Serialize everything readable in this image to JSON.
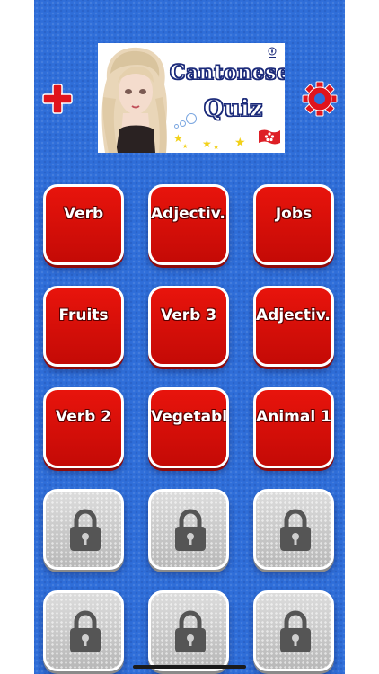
{
  "header": {
    "title_line_1": "Cantonese",
    "title_line_2": "Quiz",
    "add_icon": "plus-icon",
    "settings_icon": "gear-icon"
  },
  "topics": [
    {
      "label": "Verb"
    },
    {
      "label": "Adjectiv..."
    },
    {
      "label": "Jobs"
    },
    {
      "label": "Fruits"
    },
    {
      "label": "Verb 3"
    },
    {
      "label": "Adjectiv..."
    },
    {
      "label": "Verb 2"
    },
    {
      "label": "Vegetabl..."
    },
    {
      "label": "Animal 1"
    }
  ],
  "locked_tiles": 6,
  "colors": {
    "background": "#2f6ed9",
    "tile_red": "#d90f08",
    "tile_locked": "#cfcfcf",
    "accent_red": "#e0141c",
    "lock_dark": "#555555"
  }
}
